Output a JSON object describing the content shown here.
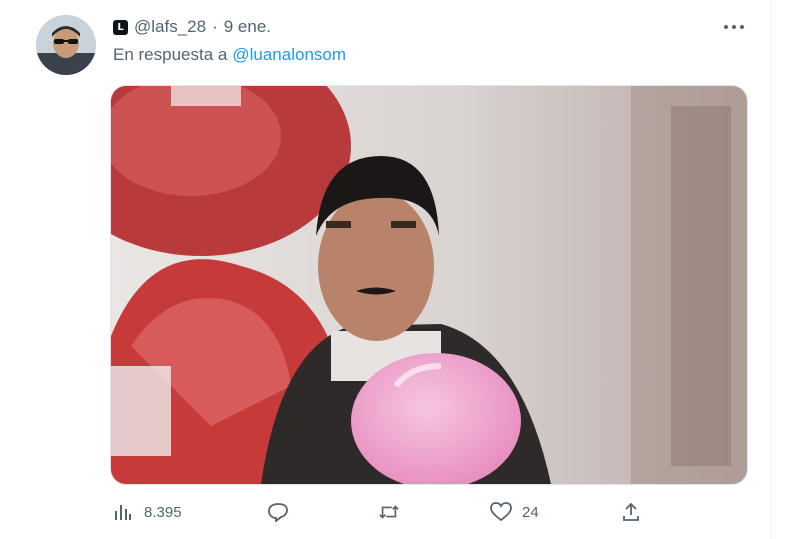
{
  "tweet": {
    "handle": "@lafs_28",
    "separator": "·",
    "date": "9 ene.",
    "badge_letter": "L",
    "reply_prefix": "En respuesta a",
    "reply_mention": "@luanalonsom"
  },
  "actions": {
    "views": "8.395",
    "replies": "",
    "retweets": "",
    "likes": "24"
  },
  "icons": [
    "avatar",
    "account-badge-icon",
    "more-icon",
    "views-icon",
    "reply-icon",
    "retweet-icon",
    "like-icon",
    "share-icon"
  ],
  "colors": {
    "link": "#1d9bf0",
    "secondary_text": "#536471"
  }
}
